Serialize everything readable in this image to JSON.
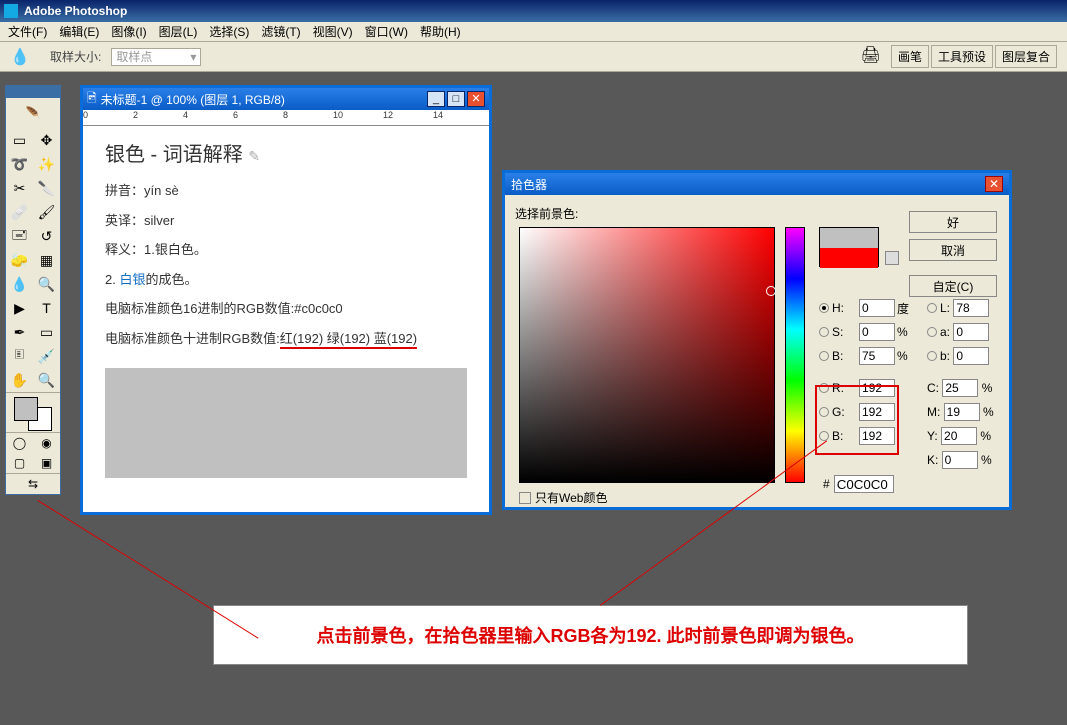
{
  "app": {
    "title": "Adobe Photoshop"
  },
  "menubar": [
    "文件(F)",
    "编辑(E)",
    "图像(I)",
    "图层(L)",
    "选择(S)",
    "滤镜(T)",
    "视图(V)",
    "窗口(W)",
    "帮助(H)"
  ],
  "optionsbar": {
    "sample_size_label": "取样大小:",
    "sample_size_value": "取样点",
    "right_tabs": [
      "画笔",
      "工具预设",
      "图层复合"
    ]
  },
  "document": {
    "title": "未标题-1 @ 100% (图层 1, RGB/8)",
    "heading": "银色 - 词语解释",
    "lines": {
      "pinyin": "拼音：yín sè",
      "english": "英译：silver",
      "meaning1": "释义：1.银白色。",
      "meaning2_pre": "2. ",
      "meaning2_link": "白银",
      "meaning2_post": "的成色。",
      "hex_line": "电脑标准颜色16进制的RGB数值:#c0c0c0",
      "dec_pre": "电脑标准颜色十进制RGB数值:",
      "dec_vals": "红(192) 绿(192) 蓝(192)"
    }
  },
  "picker": {
    "title": "拾色器",
    "select_fg": "选择前景色:",
    "ok": "好",
    "cancel": "取消",
    "custom": "自定(C)",
    "web_only": "只有Web颜色",
    "hex_label": "#",
    "hex_value": "C0C0C0",
    "hsb": {
      "H": "0",
      "S": "0",
      "B": "75"
    },
    "lab": {
      "L": "78",
      "a": "0",
      "b": "0"
    },
    "rgb": {
      "R": "192",
      "G": "192",
      "Bv": "192"
    },
    "cmyk": {
      "C": "25",
      "M": "19",
      "Y": "20",
      "K": "0"
    },
    "units": {
      "deg": "度",
      "pct": "%"
    }
  },
  "annotation": "点击前景色，在拾色器里输入RGB各为192. 此时前景色即调为银色。"
}
